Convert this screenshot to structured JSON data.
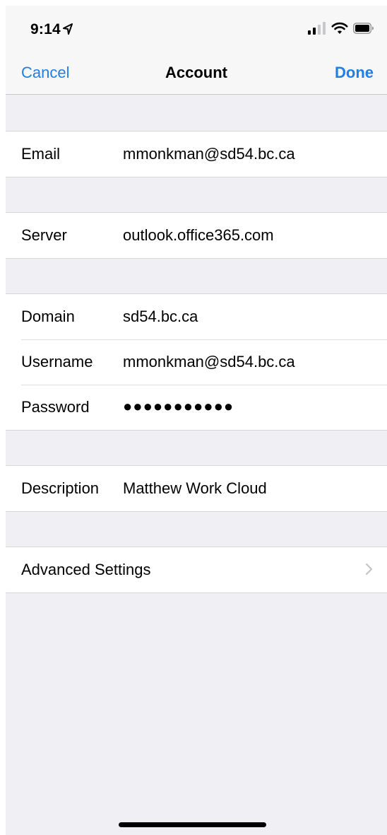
{
  "status_bar": {
    "time": "9:14",
    "icons": [
      "location-arrow-icon",
      "cellular-signal-icon",
      "wifi-icon",
      "battery-icon"
    ]
  },
  "nav": {
    "cancel_label": "Cancel",
    "title": "Account",
    "done_label": "Done"
  },
  "fields": {
    "email": {
      "label": "Email",
      "value": "mmonkman@sd54.bc.ca"
    },
    "server": {
      "label": "Server",
      "value": "outlook.office365.com"
    },
    "domain": {
      "label": "Domain",
      "value": "sd54.bc.ca"
    },
    "username": {
      "label": "Username",
      "value": "mmonkman@sd54.bc.ca"
    },
    "password": {
      "label": "Password",
      "value": "●●●●●●●●●●●"
    },
    "description": {
      "label": "Description",
      "value": "Matthew Work Cloud"
    }
  },
  "advanced": {
    "label": "Advanced Settings",
    "icon": "chevron-right-icon"
  },
  "colors": {
    "accent": "#1f7fe8",
    "background": "#efeff4",
    "bar": "#f7f7f7",
    "cell": "#ffffff",
    "separator": "#d6d6da"
  }
}
